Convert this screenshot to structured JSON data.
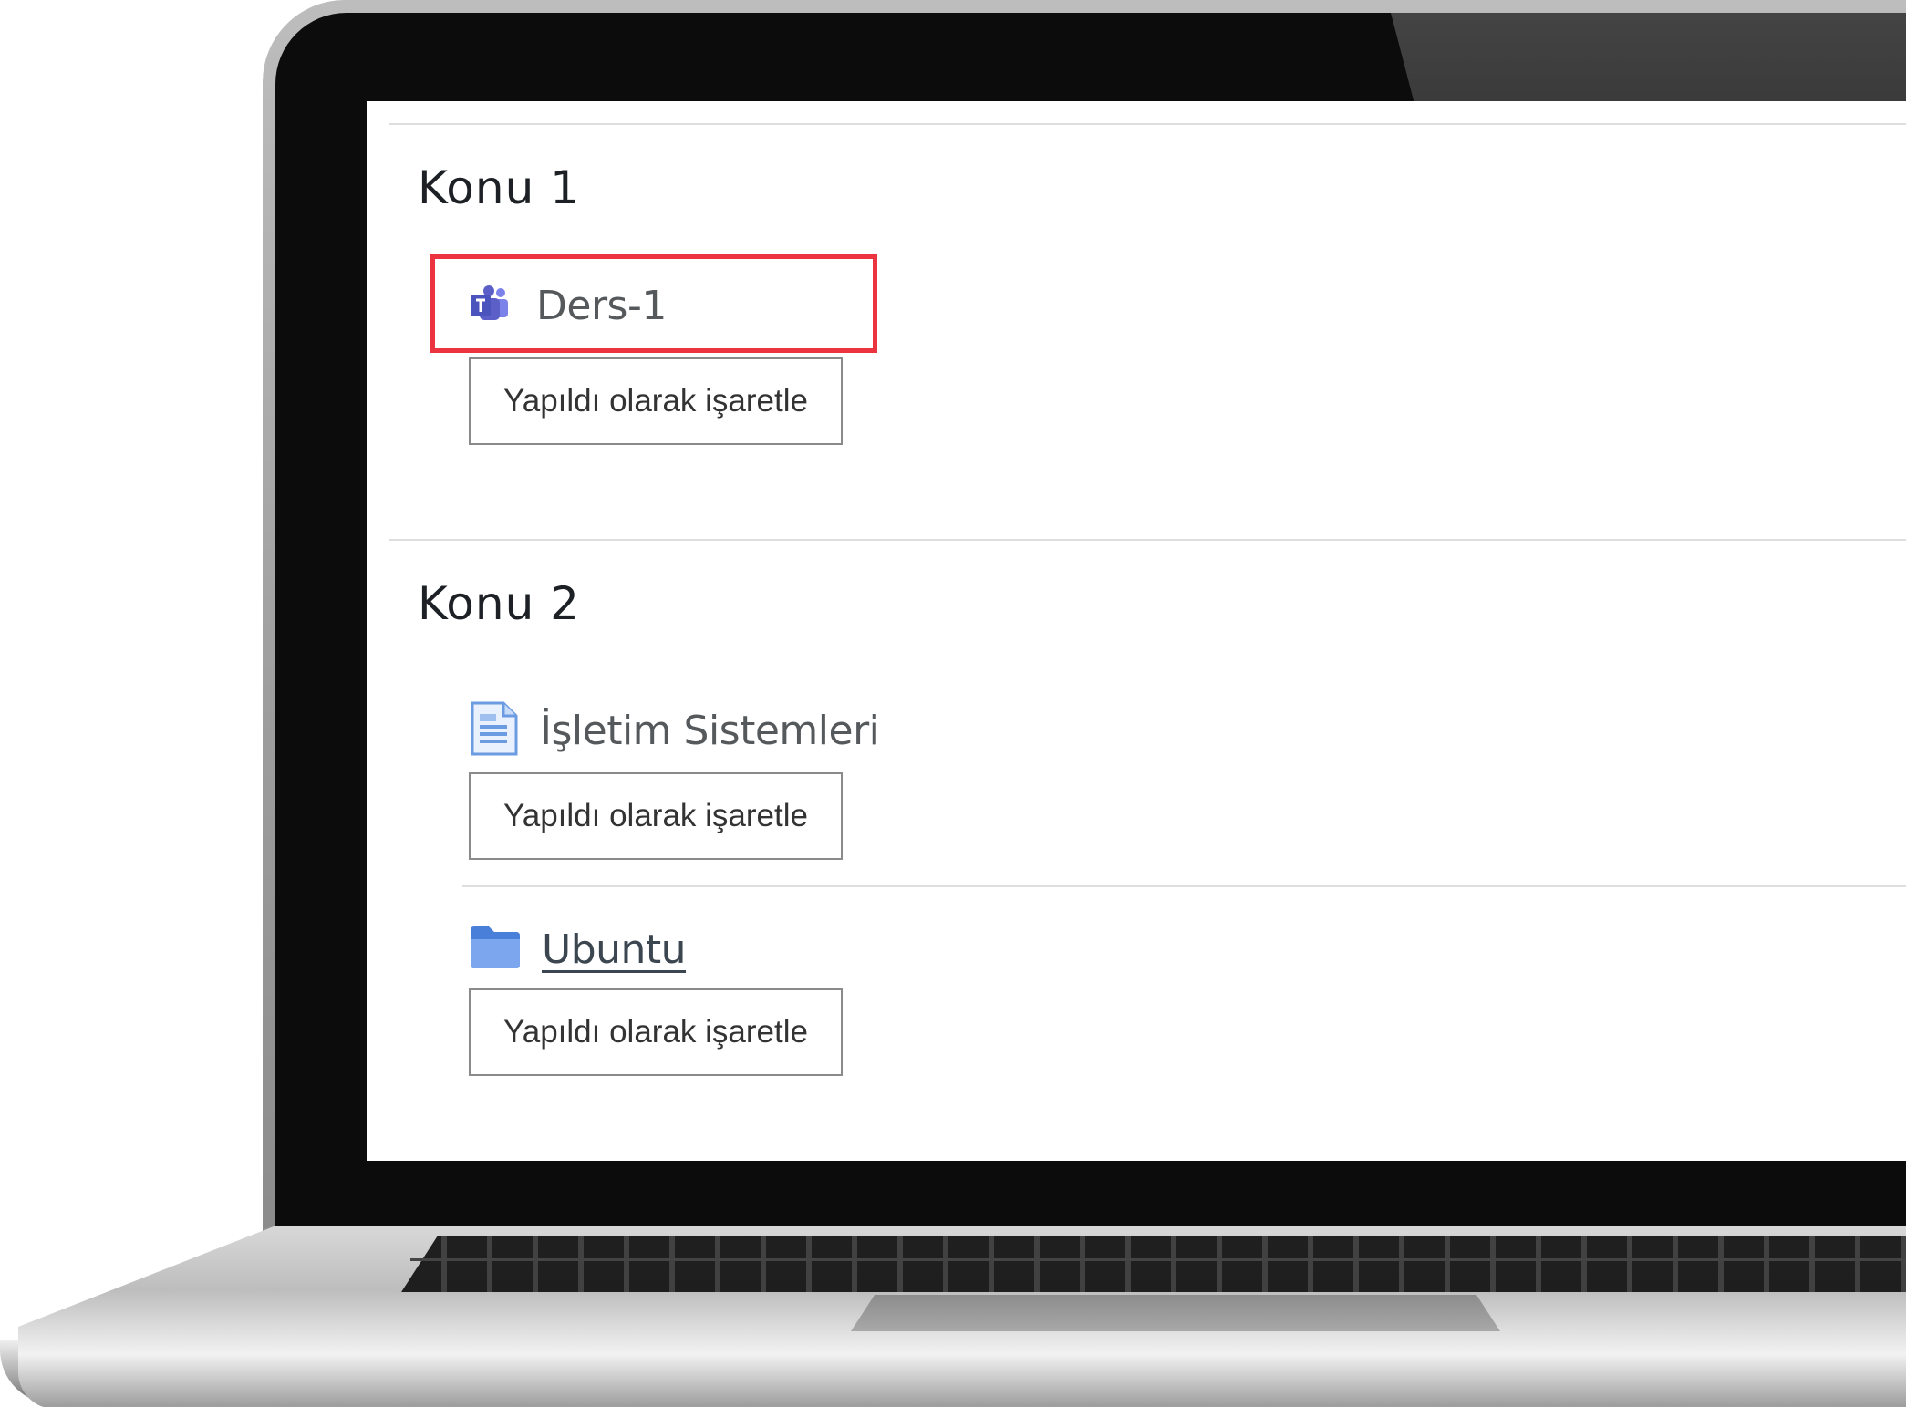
{
  "sections": [
    {
      "title": "Konu 1",
      "activities": [
        {
          "name": "Ders-1",
          "icon": "teams-icon",
          "button": "Yapıldı olarak işaretle"
        }
      ]
    },
    {
      "title": "Konu 2",
      "activities": [
        {
          "name": "İşletim Sistemleri",
          "icon": "page-icon",
          "button": "Yapıldı olarak işaretle"
        },
        {
          "name": "Ubuntu",
          "icon": "folder-icon",
          "button": "Yapıldı olarak işaretle"
        }
      ]
    }
  ],
  "colors": {
    "highlight": "#ec3340",
    "teams": "#5b5fc7",
    "folder": "#5b8fe8"
  }
}
